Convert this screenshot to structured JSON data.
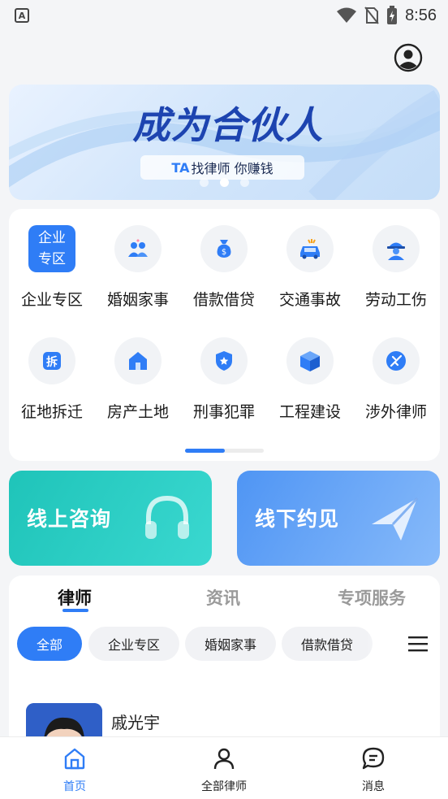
{
  "status_bar": {
    "time": "8:56",
    "app_badge": "A"
  },
  "banner": {
    "title": "成为合伙人",
    "subtitle_prefix": "TA",
    "subtitle_rest": "找律师 你赚钱",
    "pages": 3,
    "active_page": 2
  },
  "categories": {
    "enterprise_badge_line1": "企业",
    "enterprise_badge_line2": "专区",
    "items": [
      {
        "label": "企业专区",
        "icon": "enterprise-zone-icon"
      },
      {
        "label": "婚姻家事",
        "icon": "couple-icon"
      },
      {
        "label": "借款借贷",
        "icon": "money-bag-icon"
      },
      {
        "label": "交通事故",
        "icon": "car-crash-icon"
      },
      {
        "label": "劳动工伤",
        "icon": "worker-helmet-icon"
      },
      {
        "label": "征地拆迁",
        "icon": "demolition-icon"
      },
      {
        "label": "房产土地",
        "icon": "house-icon"
      },
      {
        "label": "刑事犯罪",
        "icon": "police-shield-icon"
      },
      {
        "label": "工程建设",
        "icon": "cube-icon"
      },
      {
        "label": "涉外律师",
        "icon": "globe-plane-icon"
      }
    ],
    "scroll_progress": 0.5
  },
  "consult": {
    "online_label": "线上咨询",
    "offline_label": "线下约见"
  },
  "list": {
    "tabs": [
      {
        "label": "律师",
        "active": true
      },
      {
        "label": "资讯",
        "active": false
      },
      {
        "label": "专项服务",
        "active": false
      }
    ],
    "filters": [
      {
        "label": "全部",
        "active": true
      },
      {
        "label": "企业专区",
        "active": false
      },
      {
        "label": "婚姻家事",
        "active": false
      },
      {
        "label": "借款借贷",
        "active": false
      }
    ],
    "lawyers": [
      {
        "name": "戚光宇"
      }
    ]
  },
  "bottom_nav": [
    {
      "label": "首页",
      "icon": "home-icon",
      "active": true
    },
    {
      "label": "全部律师",
      "icon": "person-icon",
      "active": false
    },
    {
      "label": "消息",
      "icon": "chat-icon",
      "active": false
    }
  ],
  "colors": {
    "primary": "#2f7df6",
    "teal": "#1fc4b9",
    "text": "#1a1a1a",
    "muted": "#9a9a9a"
  }
}
